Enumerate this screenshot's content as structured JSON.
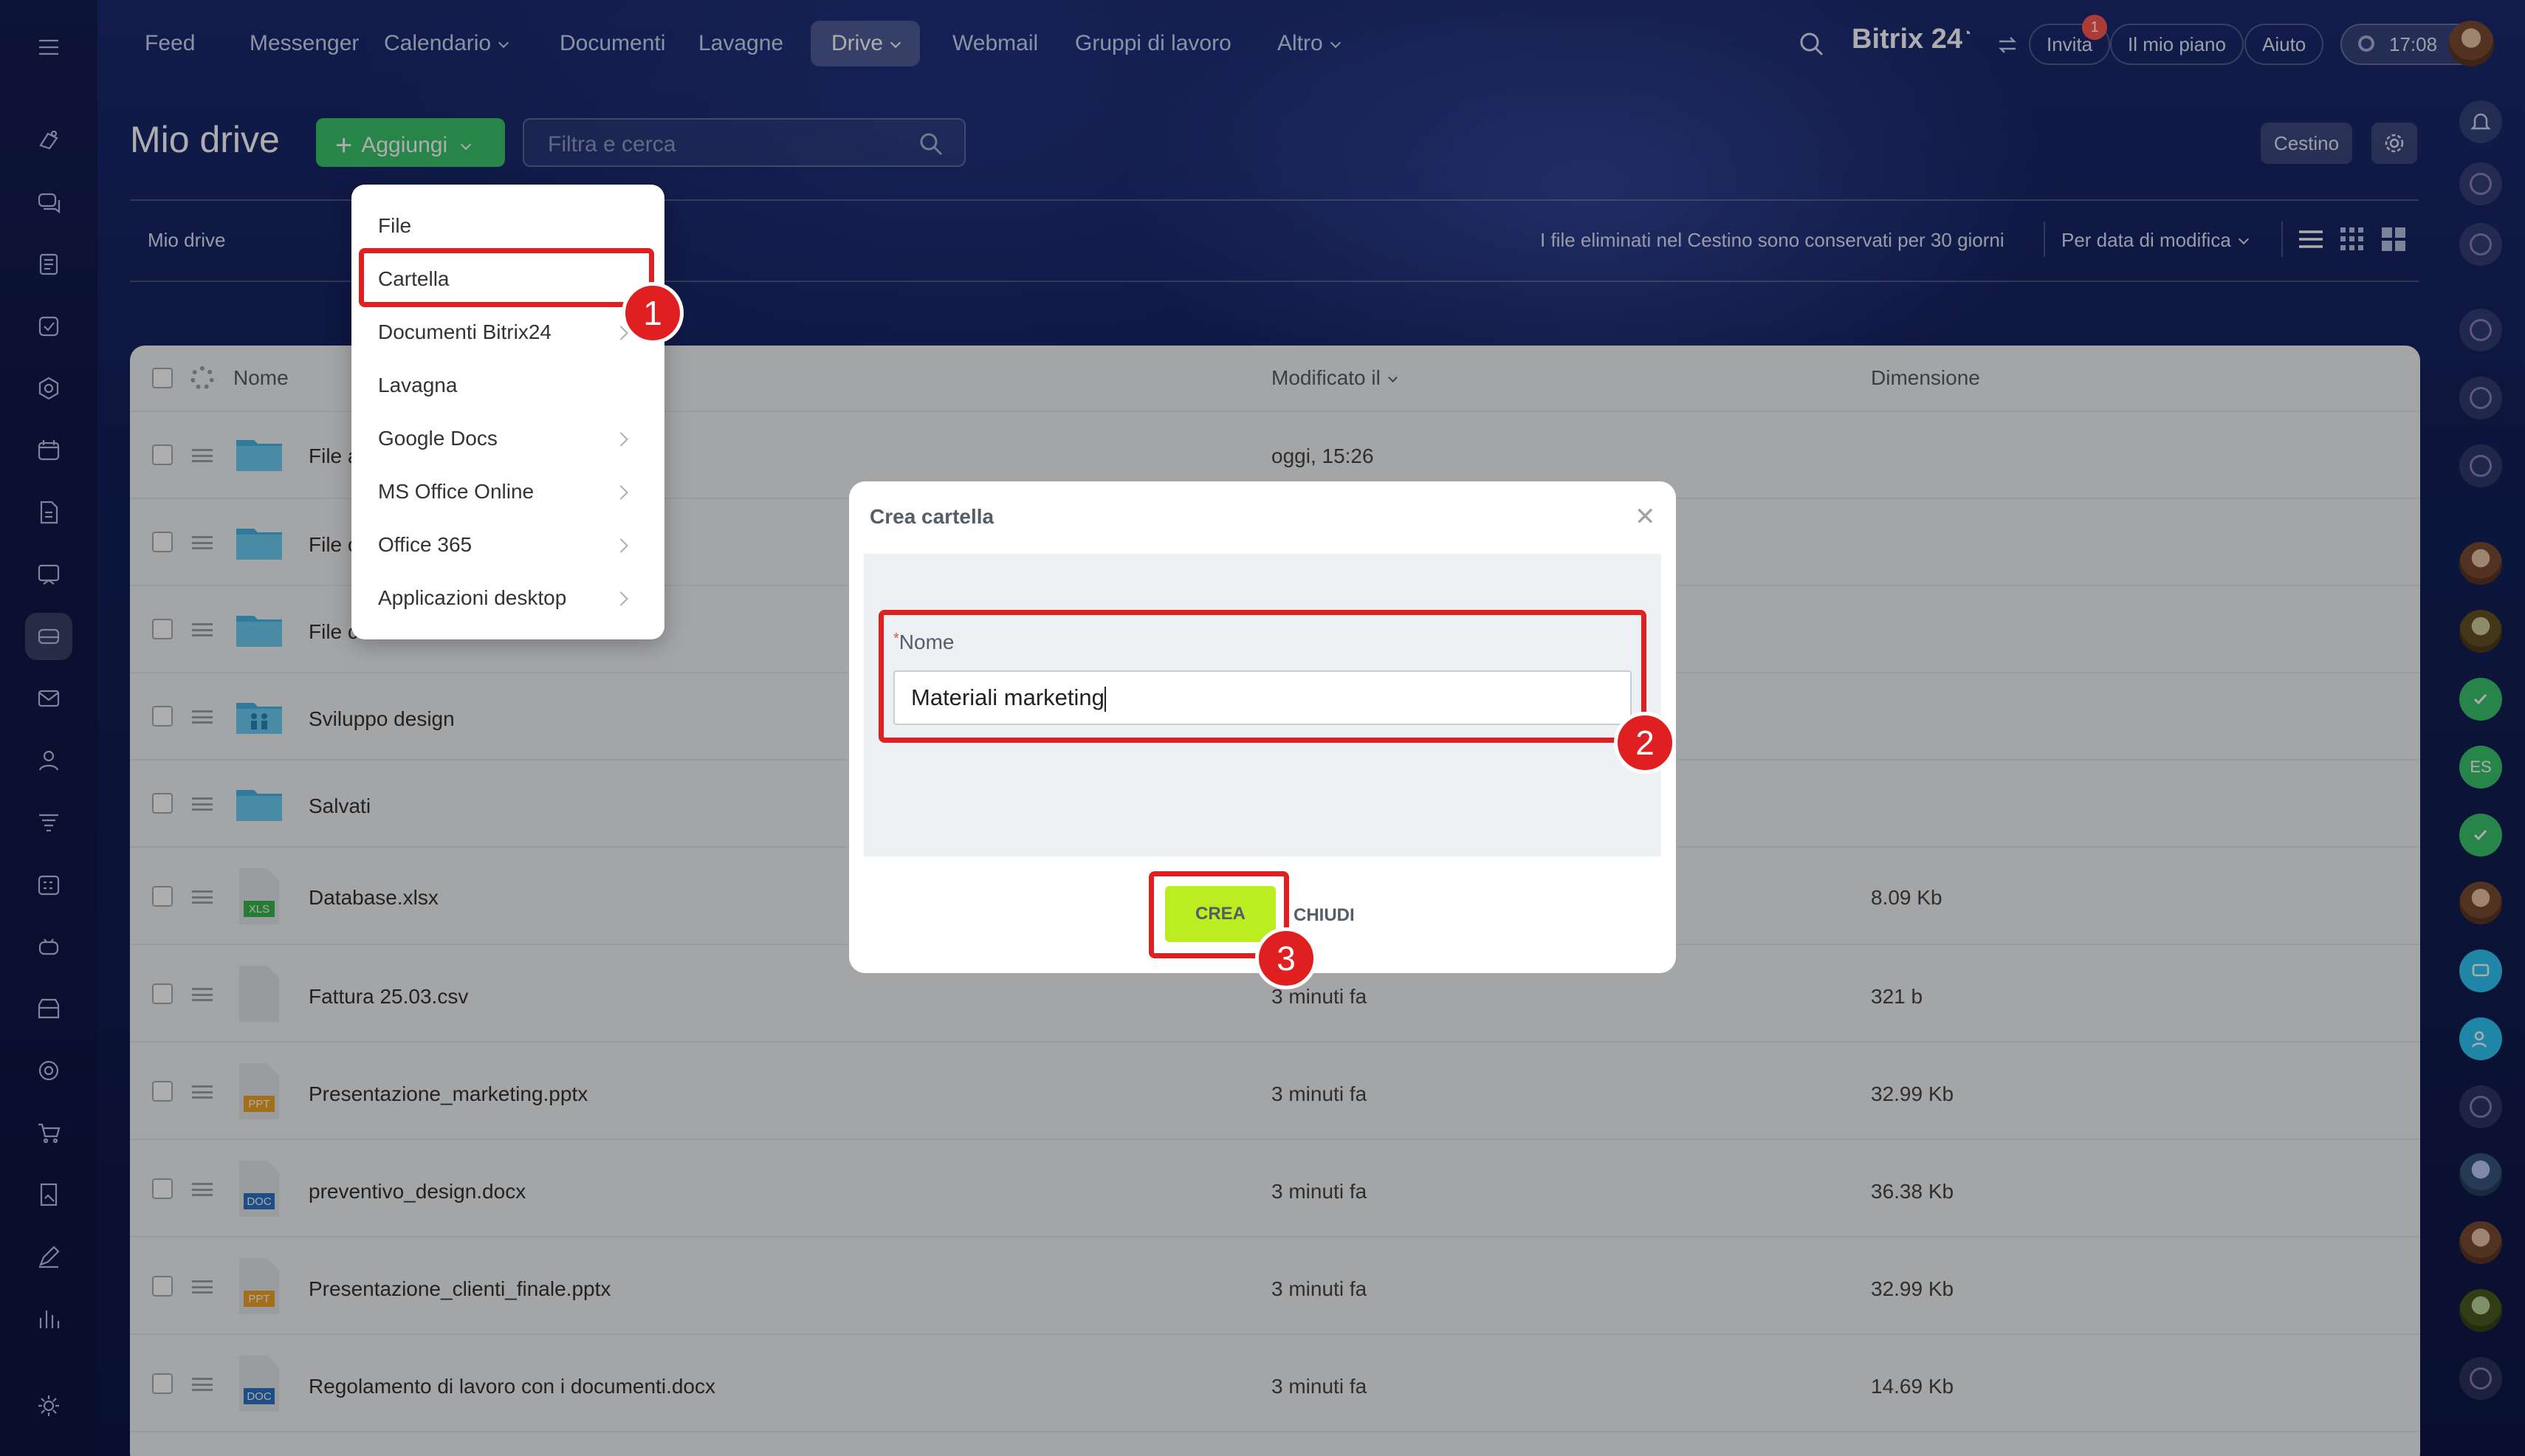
{
  "topnav": {
    "items": [
      "Feed",
      "Messenger",
      "Calendario",
      "Documenti",
      "Lavagne",
      "Drive",
      "Webmail",
      "Gruppi di lavoro",
      "Altro"
    ],
    "brand": "Bitrix 24",
    "invite_label": "Invita",
    "invite_badge": "1",
    "plan_label": "Il mio piano",
    "help_label": "Aiuto",
    "time": "17:08"
  },
  "page": {
    "title": "Mio drive",
    "add_button": "Aggiungi",
    "search_placeholder": "Filtra e cerca",
    "trash_button": "Cestino",
    "breadcrumb": "Mio drive",
    "trash_info": "I file eliminati nel Cestino sono conservati per 30 giorni",
    "sort_label": "Per data di modifica"
  },
  "table": {
    "headers": {
      "name": "Nome",
      "modified": "Modificato il",
      "size": "Dimensione"
    },
    "rows": [
      {
        "name": "File a",
        "modified": "oggi, 15:26",
        "size": "",
        "type": "folder"
      },
      {
        "name": "File c",
        "modified": "",
        "size": "",
        "type": "folder"
      },
      {
        "name": "File caricati",
        "modified": "",
        "size": "",
        "type": "folder"
      },
      {
        "name": "Sviluppo design",
        "modified": "",
        "size": "",
        "type": "folder-shared"
      },
      {
        "name": "Salvati",
        "modified": "",
        "size": "",
        "type": "folder"
      },
      {
        "name": "Database.xlsx",
        "modified": "",
        "size": "8.09 Kb",
        "type": "xls"
      },
      {
        "name": "Fattura 25.03.csv",
        "modified": "3 minuti fa",
        "size": "321 b",
        "type": "blank"
      },
      {
        "name": "Presentazione_marketing.pptx",
        "modified": "3 minuti fa",
        "size": "32.99 Kb",
        "type": "ppt"
      },
      {
        "name": "preventivo_design.docx",
        "modified": "3 minuti fa",
        "size": "36.38 Kb",
        "type": "doc"
      },
      {
        "name": "Presentazione_clienti_finale.pptx",
        "modified": "3 minuti fa",
        "size": "32.99 Kb",
        "type": "ppt"
      },
      {
        "name": "Regolamento di lavoro con i documenti.docx",
        "modified": "3 minuti fa",
        "size": "14.69 Kb",
        "type": "doc"
      }
    ]
  },
  "dropdown": {
    "items": [
      "File",
      "Cartella",
      "Documenti Bitrix24",
      "Lavagna",
      "Google Docs",
      "MS Office Online",
      "Office 365",
      "Applicazioni desktop"
    ]
  },
  "modal": {
    "title": "Crea cartella",
    "required_mark": "*",
    "field_label": "Nome",
    "field_value": "Materiali marketing",
    "create_button": "CREA",
    "close_button": "CHIUDI"
  },
  "annotations": {
    "step1": "1",
    "step2": "2",
    "step3": "3"
  },
  "colors": {
    "accent_green": "#3bc56c",
    "create_green": "#bbed21",
    "highlight_red": "#e02020"
  }
}
